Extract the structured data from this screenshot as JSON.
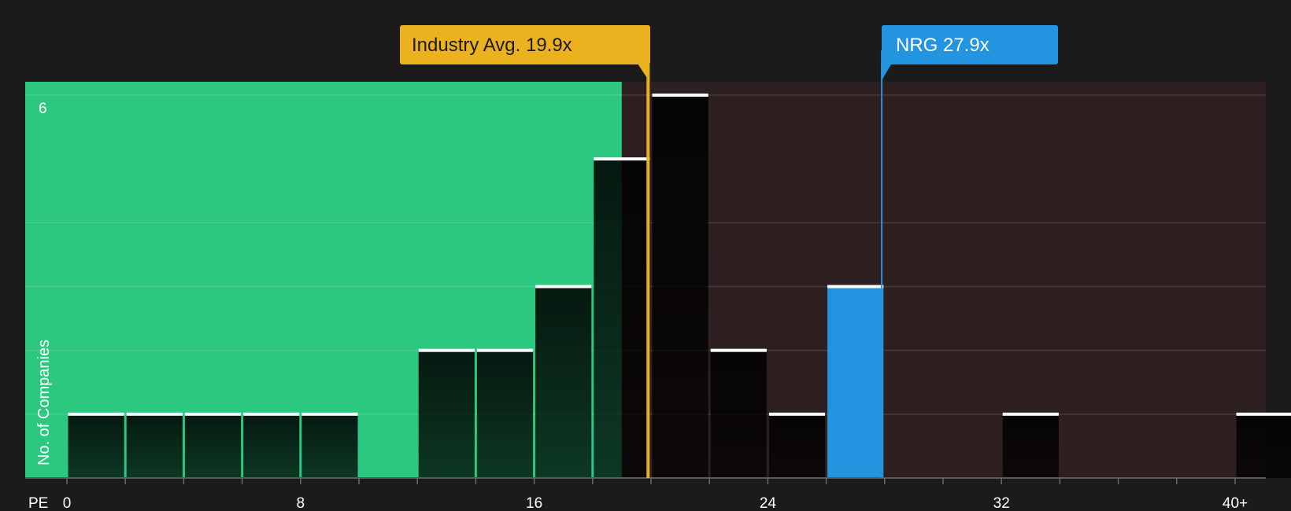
{
  "chart_data": {
    "type": "bar",
    "xlabel": "PE",
    "ylabel": "No. of Companies",
    "x_ticks": [
      0,
      8,
      16,
      24,
      32,
      40
    ],
    "x_tick_labels": [
      "0",
      "8",
      "16",
      "24",
      "32",
      "40+"
    ],
    "xlim": [
      0,
      41
    ],
    "y_tick_label": "6",
    "ylim": [
      0,
      6.2
    ],
    "bins": [
      {
        "start": 0,
        "end": 2,
        "count": 1
      },
      {
        "start": 2,
        "end": 4,
        "count": 1
      },
      {
        "start": 4,
        "end": 6,
        "count": 1
      },
      {
        "start": 6,
        "end": 8,
        "count": 1
      },
      {
        "start": 8,
        "end": 10,
        "count": 1
      },
      {
        "start": 12,
        "end": 14,
        "count": 2
      },
      {
        "start": 14,
        "end": 16,
        "count": 2
      },
      {
        "start": 16,
        "end": 18,
        "count": 3
      },
      {
        "start": 18,
        "end": 20,
        "count": 5
      },
      {
        "start": 20,
        "end": 22,
        "count": 6
      },
      {
        "start": 22,
        "end": 24,
        "count": 2
      },
      {
        "start": 24,
        "end": 26,
        "count": 1
      },
      {
        "start": 26,
        "end": 28,
        "count": 3,
        "highlight": true
      },
      {
        "start": 32,
        "end": 34,
        "count": 1
      },
      {
        "start": 40,
        "end": 42,
        "count": 1
      }
    ],
    "markers": [
      {
        "key": "industry",
        "label": "Industry Avg. 19.9x",
        "value": 19.9,
        "color": "#ecb11f",
        "text_color": "#1b1b1b"
      },
      {
        "key": "company",
        "label": "NRG 27.9x",
        "value": 27.9,
        "color": "#2394e0",
        "text_color": "#ffffff"
      }
    ],
    "regions": {
      "fair_end": 19,
      "fair_color": "#2dc87f",
      "over_color": "#2e1f20"
    },
    "colors": {
      "bar": "#232323",
      "highlight": "#2394e0",
      "cap": "#ffffff",
      "background": "#1b1b1b"
    }
  }
}
